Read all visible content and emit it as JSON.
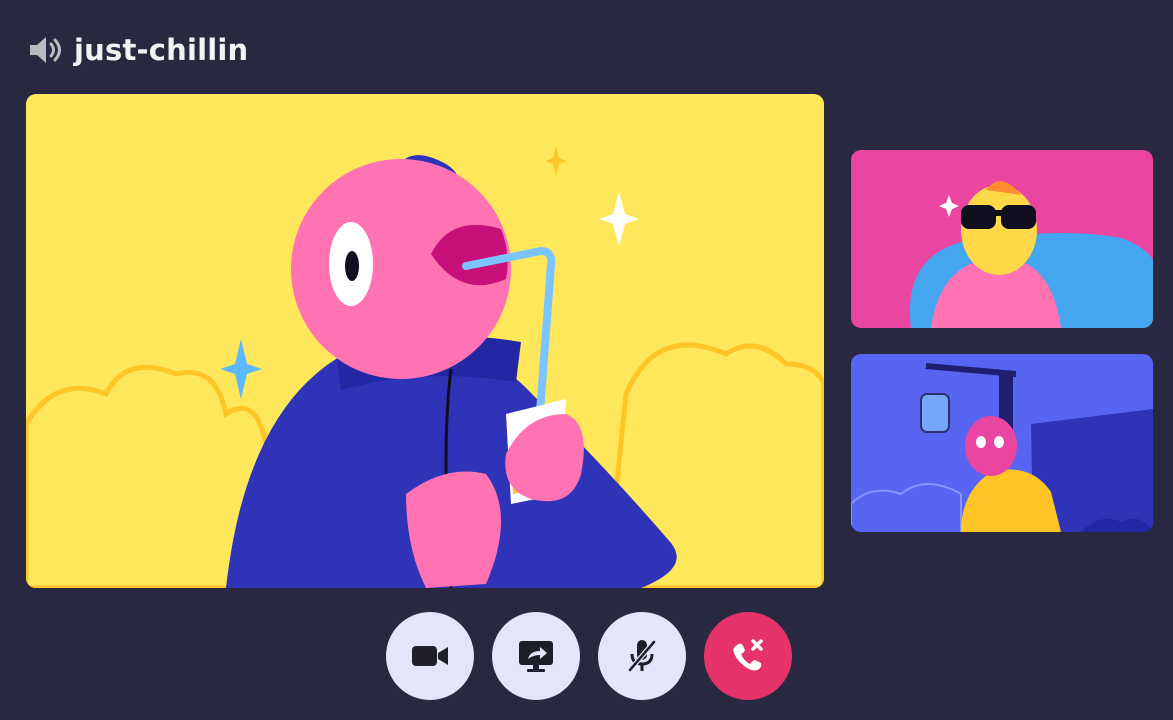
{
  "channel": {
    "name": "just-chillin",
    "icon": "speaker-icon"
  },
  "video_tiles": [
    {
      "role": "main",
      "bg": "#ffe75c"
    },
    {
      "role": "side",
      "bg": "#ea45a0"
    },
    {
      "role": "side",
      "bg": "#5865f2"
    }
  ],
  "controls": [
    {
      "icon": "camera-icon",
      "bg": "#e3e5fb"
    },
    {
      "icon": "screen-share-icon",
      "bg": "#e3e5fb"
    },
    {
      "icon": "mic-muted-icon",
      "bg": "#e3e5fb"
    },
    {
      "icon": "leave-call-icon",
      "bg": "#e5326b"
    }
  ],
  "colors": {
    "background": "#292841",
    "text": "#f2f3f5",
    "icon_dark": "#1e1f2b"
  }
}
